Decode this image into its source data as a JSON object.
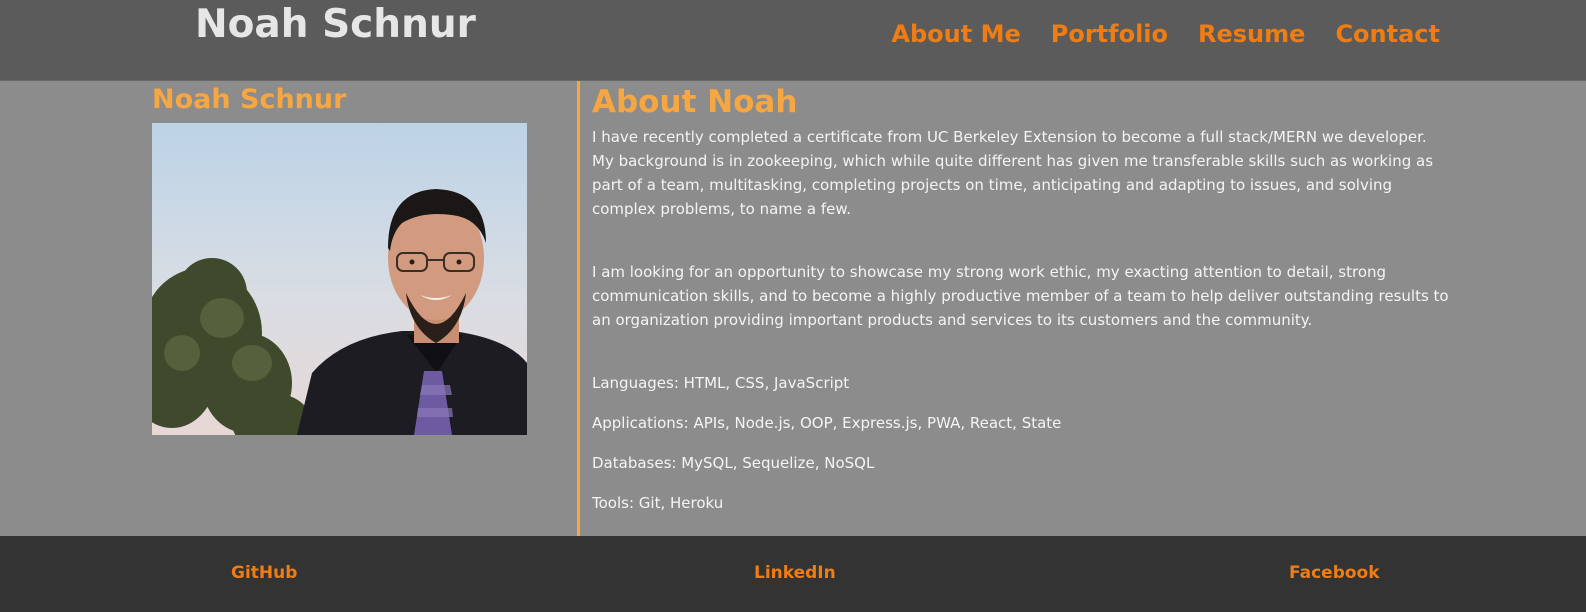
{
  "header": {
    "site_title": "Noah Schnur",
    "nav": [
      {
        "label": "About Me"
      },
      {
        "label": "Portfolio"
      },
      {
        "label": "Resume"
      },
      {
        "label": "Contact"
      }
    ]
  },
  "profile": {
    "name": "Noah Schnur"
  },
  "about": {
    "title": "About Noah",
    "paragraphs": [
      "I have recently completed a certificate from UC Berkeley Extension to become a full stack/MERN we developer. My background is in zookeeping, which while quite different has given me transferable skills such as working as part of a team, multitasking, completing projects on time, anticipating and adapting to issues, and solving complex problems, to name a few.",
      "I am looking for an opportunity to showcase my strong work ethic, my exacting attention to detail, strong communication skills, and to become a highly productive member of a team to help deliver outstanding results to an organization providing important products and services to its customers and the community."
    ],
    "skills": [
      "Languages: HTML, CSS, JavaScript",
      "Applications: APIs, Node.js, OOP, Express.js, PWA, React, State",
      "Databases: MySQL, Sequelize, NoSQL",
      "Tools: Git, Heroku"
    ]
  },
  "footer": {
    "links": [
      {
        "label": "GitHub"
      },
      {
        "label": "LinkedIn"
      },
      {
        "label": "Facebook"
      }
    ]
  },
  "colors": {
    "accent_orange": "#ef7d13",
    "heading_orange": "#f6a742",
    "header_bg": "#5b5b5b",
    "main_bg": "#8c8c8c",
    "footer_bg": "#333333"
  }
}
